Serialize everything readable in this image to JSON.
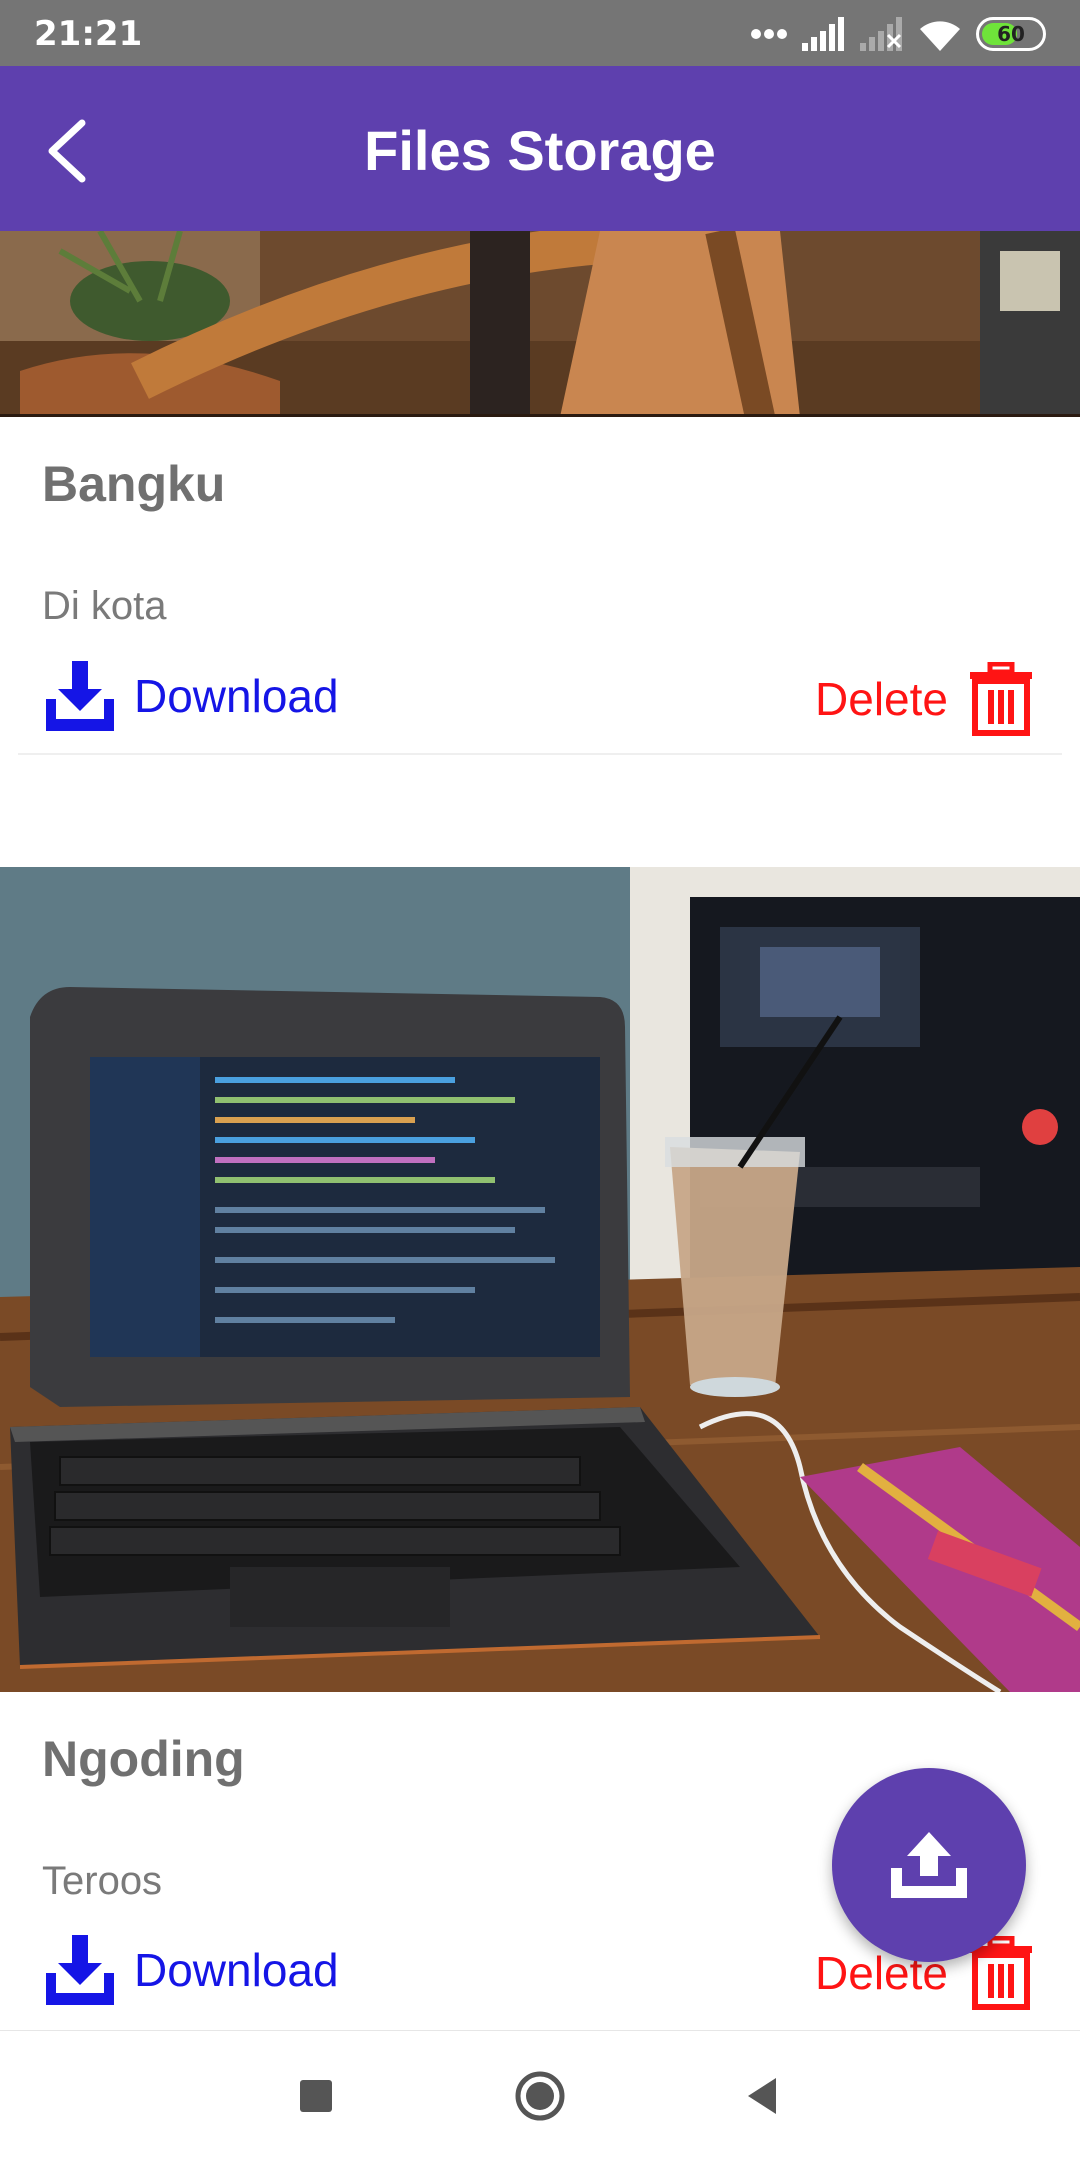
{
  "status_bar": {
    "time": "21:21",
    "battery": "60",
    "battery_level": 0.6,
    "icons": [
      "more-dots-icon",
      "signal-icon",
      "signal-off-icon",
      "wifi-icon",
      "battery-icon"
    ]
  },
  "app_bar": {
    "title": "Files Storage",
    "back_icon": "chevron-left-icon"
  },
  "files": [
    {
      "title": "Bangku",
      "description": "Di kota",
      "image": "chair-photo",
      "download_label": "Download",
      "delete_label": "Delete"
    },
    {
      "title": "Ngoding",
      "description": "Teroos",
      "image": "laptop-photo",
      "download_label": "Download",
      "delete_label": "Delete"
    }
  ],
  "fab": {
    "icon": "upload-icon"
  },
  "nav_bar": {
    "icons": [
      "recents-square-icon",
      "home-circle-icon",
      "back-triangle-icon"
    ]
  },
  "colors": {
    "primary": "#5e40ae",
    "download": "#1515e6",
    "delete": "#ff1414",
    "status_bar": "#757575"
  }
}
